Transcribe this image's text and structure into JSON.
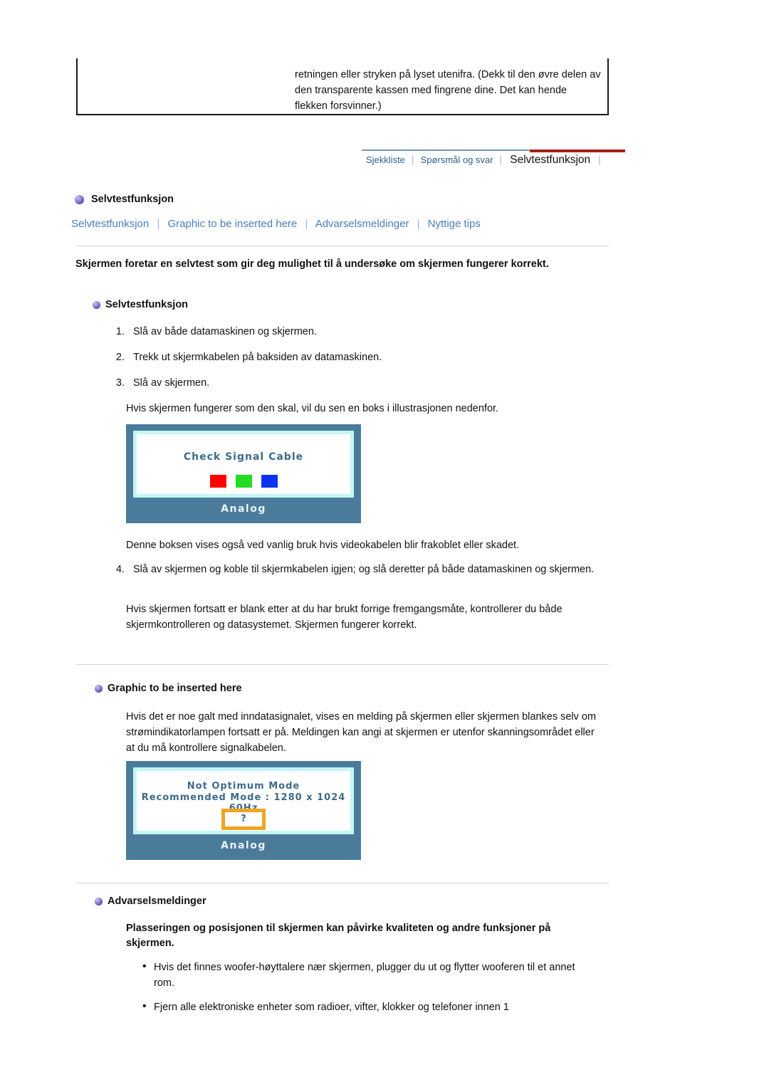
{
  "top_box": {
    "text": "retningen eller stryken på lyset utenifra. (Dekk til den øvre delen av den transparente kassen med fingrene dine. Det kan hende flekken forsvinner.)"
  },
  "tabstrip": {
    "tabs": [
      {
        "label": "Sjekkliste",
        "active": false
      },
      {
        "label": "Spørsmål og svar",
        "active": false
      },
      {
        "label": "Selvtestfunksjon",
        "active": true
      }
    ],
    "separator": "⌶",
    "rule_color": "#6f95b4",
    "active_rule_color": "#a41f17"
  },
  "page": {
    "heading": "Selvtestfunksjon",
    "sublinks": [
      "Selvtestfunksjon",
      "Graphic to be inserted here",
      "Advarselsmeldinger",
      "Nyttige tips"
    ],
    "sublink_separator": "|",
    "link_color": "#4a7eb5"
  },
  "section_selftest": {
    "lead": "Skjermen foretar en selvtest som gir deg mulighet til å undersøke om skjermen fungerer korrekt.",
    "heading": "Selvtestfunksjon",
    "steps": [
      {
        "num": "1.",
        "text": "Slå av både datamaskinen og skjermen."
      },
      {
        "num": "2.",
        "text": "Trekk ut skjermkabelen på baksiden av datamaskinen."
      },
      {
        "num": "3.",
        "text": "Slå av skjermen."
      }
    ],
    "note_after_steps": "Hvis skjermen fungerer som den skal, vil du sen en boks i illustrasjonen nedenfor.",
    "note_after_image": "Denne boksen vises også ved vanlig bruk hvis videokabelen blir frakoblet eller skadet.",
    "step4": {
      "num": "4.",
      "text": "Slå av skjermen og koble til skjermkabelen igjen; og slå deretter på både datamaskinen og skjermen."
    },
    "closing": "Hvis skjermen fortsatt er blank etter at du har brukt forrige fremgangsmåte, kontrollerer du både skjermkontrolleren og datasystemet. Skjermen fungerer korrekt."
  },
  "monitor_check": {
    "osd_title": "Check Signal Cable",
    "analog_label": "Analog",
    "frame_color": "#4b7b9b",
    "inner_border_color": "#c5f5f5",
    "osd_text_color": "#3e6a8c",
    "squares": [
      {
        "name": "red-square",
        "color": "#ff0000"
      },
      {
        "name": "green-square",
        "color": "#22dd22"
      },
      {
        "name": "blue-square",
        "color": "#0b33ee"
      }
    ]
  },
  "section_graphic": {
    "heading": "Graphic to be inserted here",
    "paragraph": "Hvis det er noe galt med inndatasignalet, vises en melding på skjermen eller skjermen blankes selv om strømindikatorlampen fortsatt er på. Meldingen kan angi at skjermen er utenfor skanningsområdet eller at du må kontrollere signalkabelen."
  },
  "monitor_mode": {
    "osd_line1": "Not Optimum Mode",
    "osd_line2": "Recommended Mode : 1280 x 1024  60Hz",
    "question_mark": "?",
    "analog_label": "Analog",
    "question_box_border_color": "#f0a520"
  },
  "section_warnings": {
    "heading": "Advarselsmeldinger",
    "lead": "Plasseringen og posisjonen til skjermen kan påvirke kvaliteten og andre funksjoner på skjermen.",
    "bullets": [
      "Hvis det finnes woofer-høyttalere nær skjermen, plugger du ut og flytter wooferen til et annet rom.",
      "Fjern alle elektroniske enheter som radioer, vifter, klokker og telefoner innen 1"
    ],
    "bullet_glyph": "•"
  }
}
